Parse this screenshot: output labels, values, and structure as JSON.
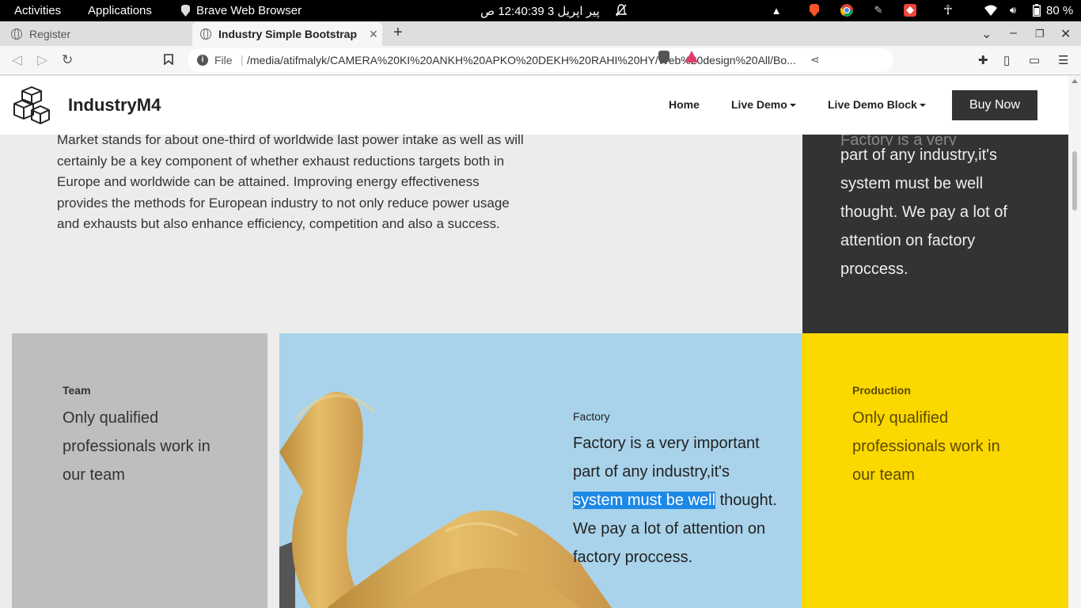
{
  "system_bar": {
    "activities": "Activities",
    "applications": "Applications",
    "app_name": "Brave Web Browser",
    "clock": "پیر اپریل 3  12:40:39 ص",
    "battery": "80 %"
  },
  "tabs": [
    {
      "label": "Register",
      "active": false
    },
    {
      "label": "Industry Simple Bootstrap",
      "active": true
    }
  ],
  "address_bar": {
    "scheme": "File",
    "url": "/media/atifmalyk/CAMERA%20KI%20ANKH%20APKO%20DEKH%20RAHI%20HY/Web%20design%20All/Bo..."
  },
  "site": {
    "brand": "IndustryM4",
    "nav": {
      "home": "Home",
      "live_demo": "Live Demo",
      "live_demo_block": "Live Demo Block",
      "buy_now": "Buy Now"
    },
    "intro_text": "Market stands for about one-third of worldwide last power intake as well as will certainly be a key component of whether exhaust reductions targets both in Europe and worldwide can be attained. Improving energy effectiveness provides the methods for European industry to not only reduce power usage and exhausts but also enhance efficiency, competition and also a success.",
    "dark_panel": {
      "cut_text": "Factory is a very important",
      "text": "part of any industry,it's system must be well thought. We pay a lot of attention on factory proccess."
    },
    "team": {
      "label": "Team",
      "text": "Only qualified professionals work in our team"
    },
    "factory": {
      "label": "Factory",
      "text_before": "Factory is a very important part of any industry,it's ",
      "selected": "system must be well",
      "text_after": " thought. We pay a lot of attention on factory proccess."
    },
    "production": {
      "label": "Production",
      "text": "Only qualified professionals work in our team"
    }
  },
  "colors": {
    "dark_panel": "#333333",
    "gray_card": "#bebebe",
    "sky": "#a9d3ea",
    "yellow_card": "#fbd800",
    "selection": "#1e88e5"
  }
}
